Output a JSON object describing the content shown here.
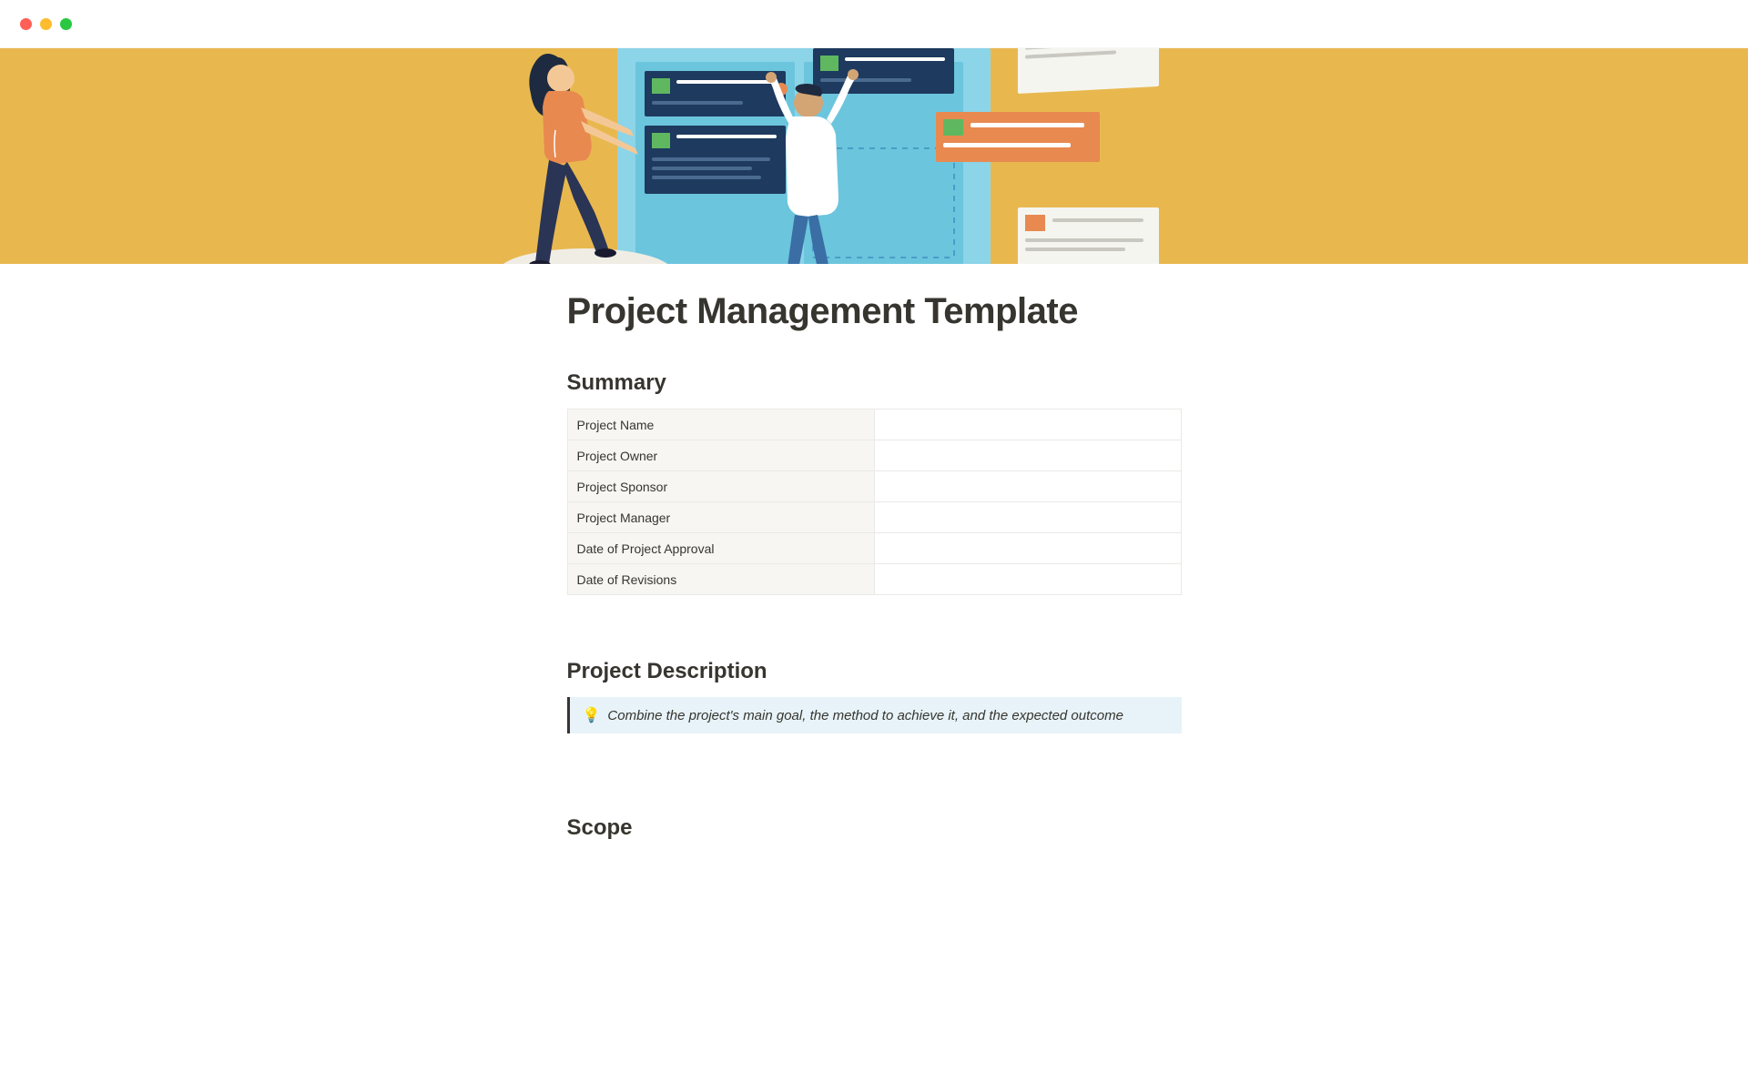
{
  "page": {
    "title": "Project Management Template"
  },
  "sections": {
    "summary": {
      "heading": "Summary",
      "rows": [
        {
          "label": "Project Name",
          "value": ""
        },
        {
          "label": "Project Owner",
          "value": ""
        },
        {
          "label": "Project Sponsor",
          "value": ""
        },
        {
          "label": "Project Manager",
          "value": ""
        },
        {
          "label": "Date of Project Approval",
          "value": ""
        },
        {
          "label": "Date of Revisions",
          "value": ""
        }
      ]
    },
    "description": {
      "heading": "Project Description",
      "callout_icon": "💡",
      "callout_text": "Combine the project's main goal, the method to achieve it, and the expected outcome"
    },
    "scope": {
      "heading_partial": "Scope"
    }
  }
}
